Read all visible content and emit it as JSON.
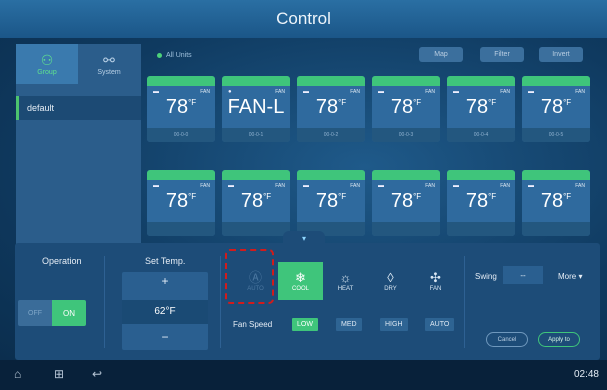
{
  "window": {
    "title": "Control"
  },
  "sidebar": {
    "tabs": [
      {
        "label": "Group",
        "icon": "group-icon",
        "active": true
      },
      {
        "label": "System",
        "icon": "system-icon",
        "active": false
      }
    ],
    "items": [
      {
        "label": "default"
      }
    ]
  },
  "units_header": {
    "all_units_label": "All Units",
    "buttons": [
      "Map",
      "Filter",
      "Invert"
    ]
  },
  "units": [
    {
      "mode_icon": "cool",
      "fan_label": "FAN",
      "temp": "78",
      "unit": "°F",
      "addr": "00-0-0"
    },
    {
      "mode_icon": "fan",
      "fan_label": "FAN",
      "temp": "FAN-L",
      "unit": "",
      "addr": "00-0-1"
    },
    {
      "mode_icon": "cool",
      "fan_label": "FAN",
      "temp": "78",
      "unit": "°F",
      "addr": "00-0-2"
    },
    {
      "mode_icon": "cool",
      "fan_label": "FAN",
      "temp": "78",
      "unit": "°F",
      "addr": "00-0-3"
    },
    {
      "mode_icon": "cool",
      "fan_label": "FAN",
      "temp": "78",
      "unit": "°F",
      "addr": "00-0-4"
    },
    {
      "mode_icon": "cool",
      "fan_label": "FAN",
      "temp": "78",
      "unit": "°F",
      "addr": "00-0-5"
    },
    {
      "mode_icon": "cool",
      "fan_label": "FAN",
      "temp": "78",
      "unit": "°F",
      "addr": ""
    },
    {
      "mode_icon": "cool",
      "fan_label": "FAN",
      "temp": "78",
      "unit": "°F",
      "addr": ""
    },
    {
      "mode_icon": "cool",
      "fan_label": "FAN",
      "temp": "78",
      "unit": "°F",
      "addr": ""
    },
    {
      "mode_icon": "cool",
      "fan_label": "FAN",
      "temp": "78",
      "unit": "°F",
      "addr": ""
    },
    {
      "mode_icon": "cool",
      "fan_label": "FAN",
      "temp": "78",
      "unit": "°F",
      "addr": ""
    },
    {
      "mode_icon": "cool",
      "fan_label": "FAN",
      "temp": "78",
      "unit": "°F",
      "addr": ""
    }
  ],
  "panel": {
    "operation": {
      "title": "Operation",
      "off": "OFF",
      "on": "ON",
      "state": "ON"
    },
    "set_temp": {
      "title": "Set Temp.",
      "plus": "+",
      "value": "62°F",
      "minus": "−"
    },
    "modes": [
      {
        "label": "AUTO",
        "icon": "auto-icon",
        "state": "disabled"
      },
      {
        "label": "COOL",
        "icon": "snowflake-icon",
        "state": "selected"
      },
      {
        "label": "HEAT",
        "icon": "sun-icon",
        "state": "normal"
      },
      {
        "label": "DRY",
        "icon": "droplet-icon",
        "state": "normal"
      },
      {
        "label": "FAN",
        "icon": "fan-icon",
        "state": "normal"
      }
    ],
    "fan_speed": {
      "label": "Fan Speed",
      "options": [
        "LOW",
        "MED",
        "HIGH",
        "AUTO"
      ],
      "selected": "LOW"
    },
    "swing": {
      "label": "Swing",
      "value": "--"
    },
    "more": {
      "label": "More ▾"
    },
    "cancel": "Cancel",
    "apply": "Apply to"
  },
  "navbar": {
    "time": "02:48"
  },
  "colors": {
    "accent": "#3fc57b",
    "highlight": "#d21b1b",
    "title": "#1b5688"
  }
}
